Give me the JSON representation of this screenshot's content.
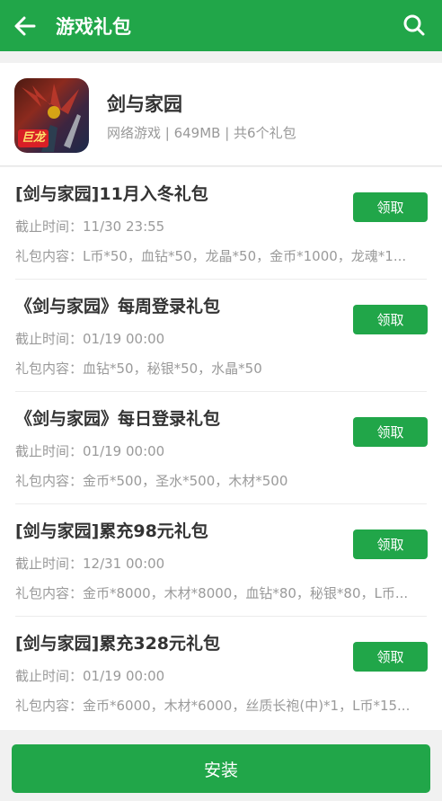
{
  "header": {
    "title": "游戏礼包"
  },
  "game": {
    "name": "剑与家园",
    "meta": "网络游戏 | 649MB | 共6个礼包",
    "icon_badge": "巨龙"
  },
  "gifts": [
    {
      "title": "[剑与家园]11月入冬礼包",
      "deadline": "截止时间：11/30 23:55",
      "content": "礼包内容：L币*50，血钻*50，龙晶*50，金币*1000，龙魂*1...",
      "button": "领取"
    },
    {
      "title": "《剑与家园》每周登录礼包",
      "deadline": "截止时间：01/19 00:00",
      "content": "礼包内容：血钻*50，秘银*50，水晶*50",
      "button": "领取"
    },
    {
      "title": "《剑与家园》每日登录礼包",
      "deadline": "截止时间：01/19 00:00",
      "content": "礼包内容：金币*500，圣水*500，木材*500",
      "button": "领取"
    },
    {
      "title": "[剑与家园]累充98元礼包",
      "deadline": "截止时间：12/31 00:00",
      "content": "礼包内容：金币*8000，木材*8000，血钻*80，秘银*80，L币...",
      "button": "领取"
    },
    {
      "title": "[剑与家园]累充328元礼包",
      "deadline": "截止时间：01/19 00:00",
      "content": "礼包内容：金币*6000，木材*6000，丝质长袍(中)*1，L币*15...",
      "button": "领取"
    }
  ],
  "install": {
    "label": "安装"
  },
  "colors": {
    "primary": "#21a649",
    "background": "#f1f1f1"
  }
}
